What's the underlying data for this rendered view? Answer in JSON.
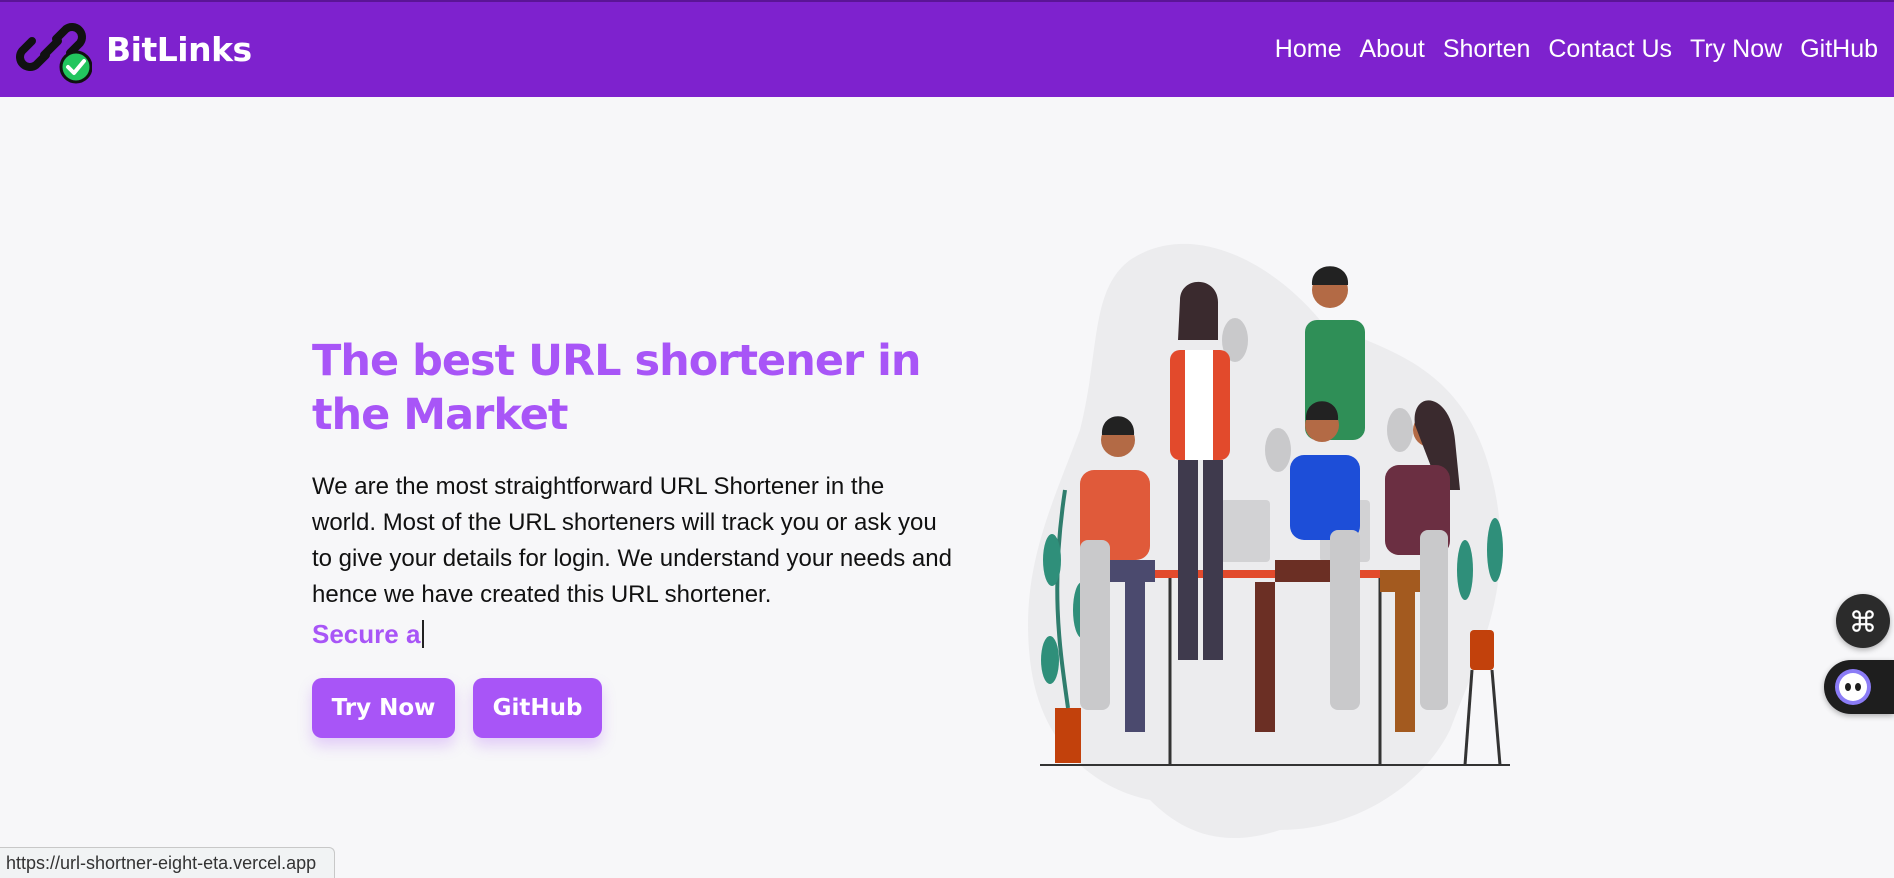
{
  "brand": {
    "name": "BitLinks"
  },
  "nav": {
    "items": [
      "Home",
      "About",
      "Shorten",
      "Contact Us",
      "Try Now",
      "GitHub"
    ]
  },
  "hero": {
    "title": "The best URL shortener in the Market",
    "description": "We are the most straightforward URL Shortener in the world. Most of the URL shorteners will track you or ask you to give your details for login. We understand your needs and hence we have created this URL shortener.",
    "typed_text": "Secure a",
    "buttons": {
      "try_now": "Try Now",
      "github": "GitHub"
    }
  },
  "status_url": "https://url-shortner-eight-eta.vercel.app",
  "colors": {
    "navbar": "#7e22ce",
    "accent": "#a855f7",
    "logo_check": "#22c55e"
  },
  "icons": {
    "logo": "link-check-icon",
    "fab_top": "command-icon",
    "fab_bottom": "bot-face-icon"
  }
}
